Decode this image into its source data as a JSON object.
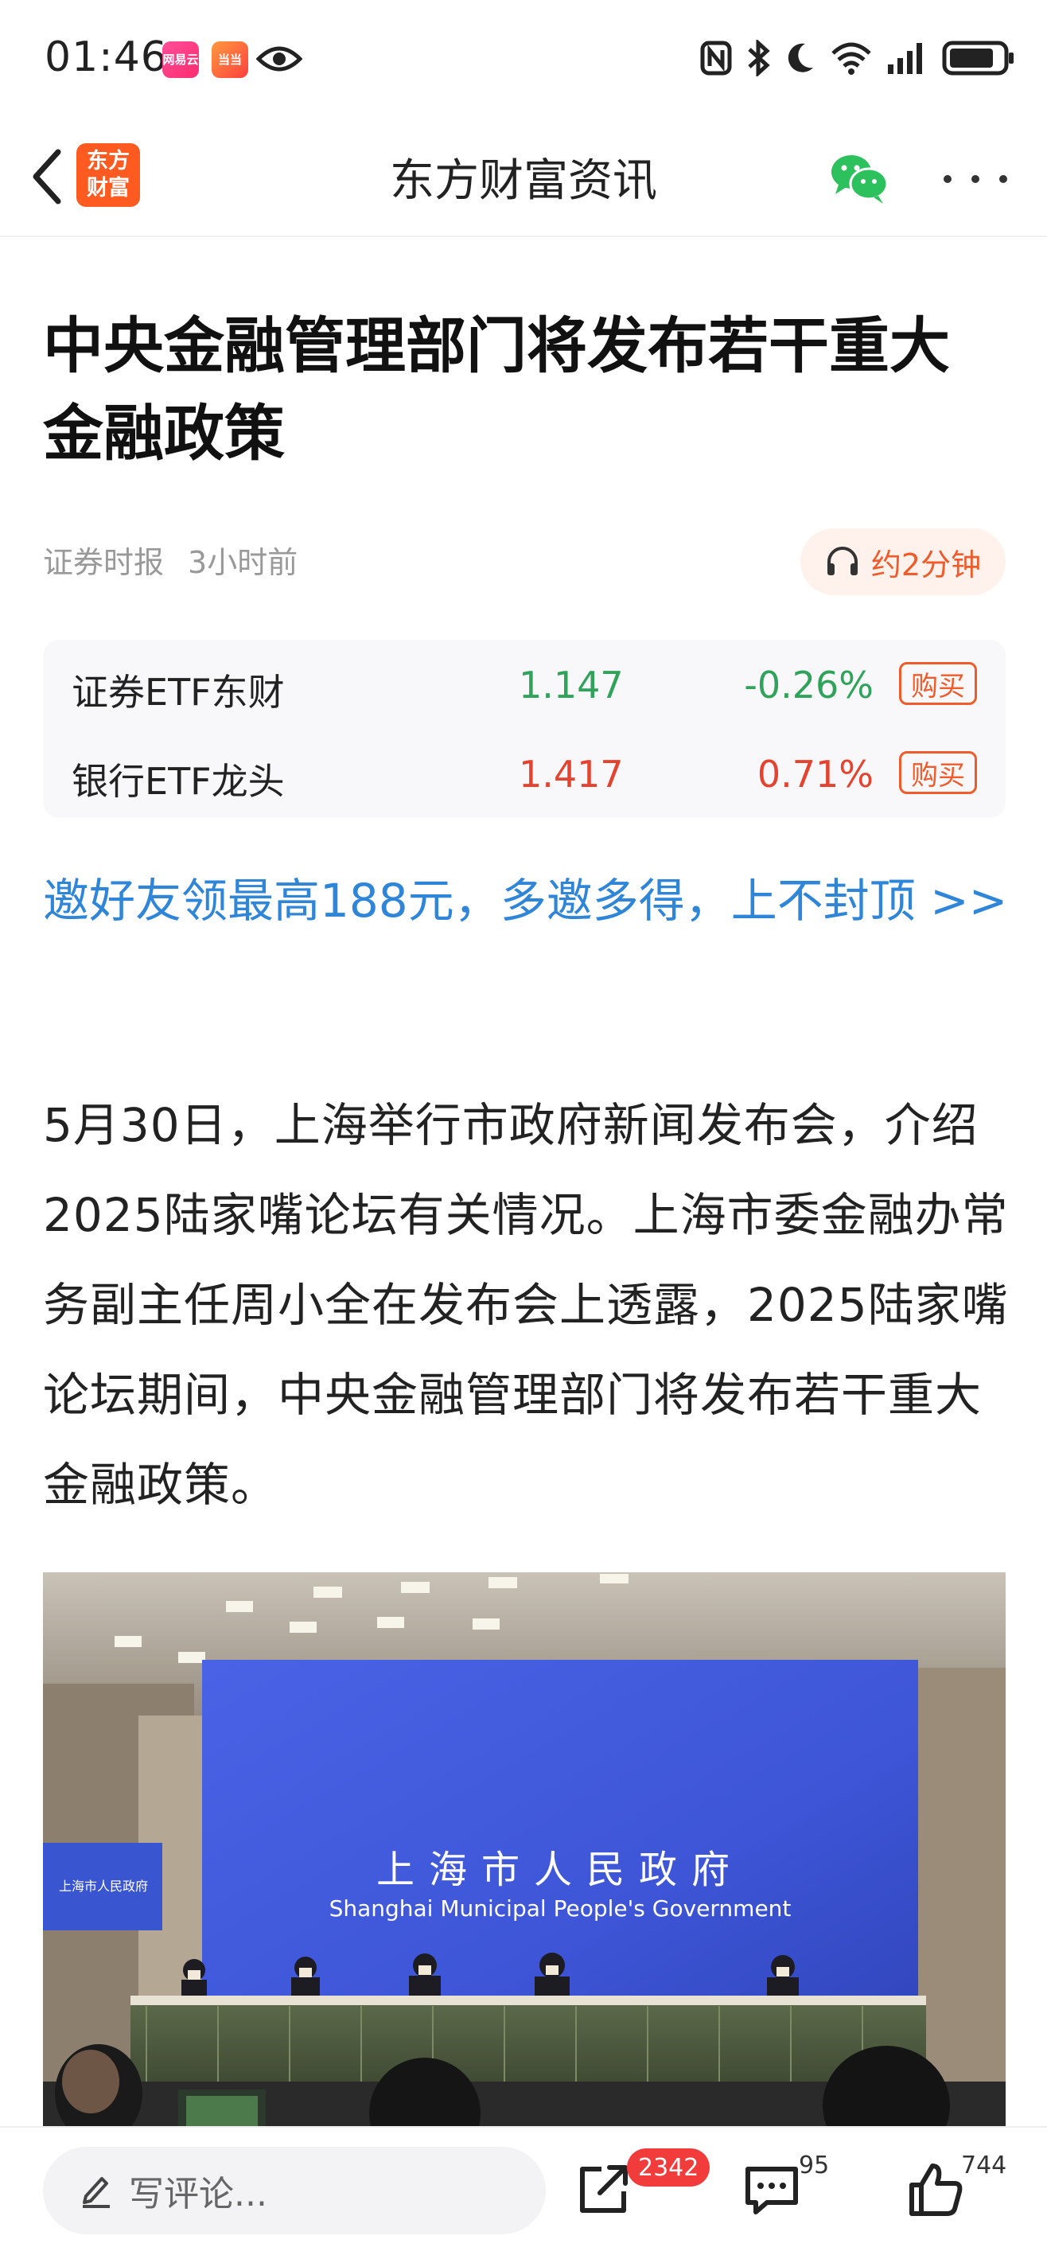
{
  "status_bar": {
    "time": "01:46",
    "app1_label": "网易云",
    "app2_label": "当当",
    "icons": [
      "eye-icon",
      "nfc-icon",
      "bluetooth-icon",
      "moon-icon",
      "wifi-icon",
      "signal-icon",
      "battery-icon"
    ]
  },
  "nav": {
    "title": "东方财富资讯",
    "logo_line1": "东方",
    "logo_line2": "财富",
    "back_icon": "chevron-left-icon",
    "share_icon": "wechat-icon",
    "more_icon": "more-icon"
  },
  "article": {
    "headline": "中央金融管理部门将发布若干重大金融政策",
    "source": "证券时报",
    "time_ago": "3小时前",
    "listen_label": "约2分钟",
    "promo": "邀好友领最高188元，多邀多得，上不封顶 >>",
    "body": "5月30日，上海举行市政府新闻发布会，介绍2025陆家嘴论坛有关情况。上海市委金融办常务副主任周小全在发布会上透露，2025陆家嘴论坛期间，中央金融管理部门将发布若干重大金融政策。",
    "photo": {
      "backdrop_cn": "上海市人民政府",
      "backdrop_en": "Shanghai Municipal People's Government",
      "side_screen": "上海市人民政府"
    }
  },
  "etf": {
    "rows": [
      {
        "name": "证券ETF东财",
        "price": "1.147",
        "change": "-0.26%",
        "buy": "购买",
        "color": "#2fa35a"
      },
      {
        "name": "银行ETF龙头",
        "price": "1.417",
        "change": "0.71%",
        "buy": "购买",
        "color": "#e4432f"
      }
    ]
  },
  "bottom_bar": {
    "comment_placeholder": "写评论...",
    "share_count": "2342",
    "comment_count": "95",
    "like_count": "744"
  },
  "colors": {
    "accent": "#ef5b2b",
    "link": "#2f86d9",
    "up": "#e4432f",
    "down": "#2fa35a",
    "badge": "#f23c3c"
  }
}
